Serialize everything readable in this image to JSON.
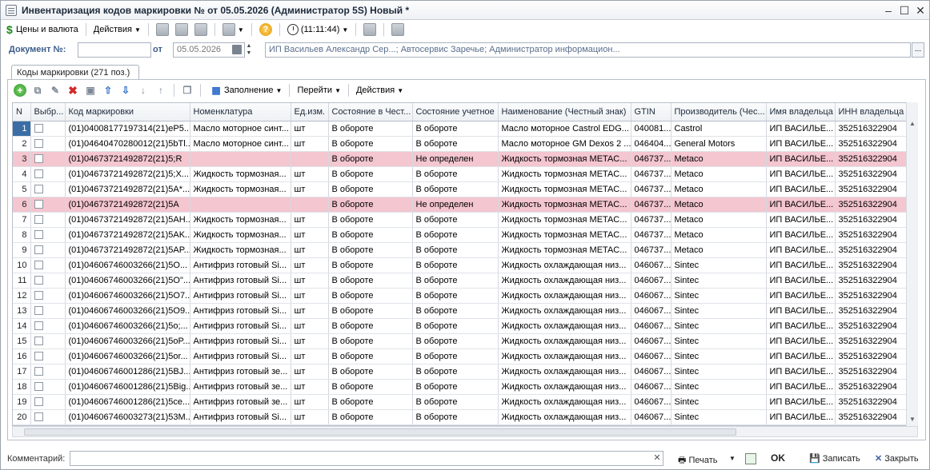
{
  "window": {
    "title": "Инвентаризация кодов маркировки №  от 05.05.2026 (Администратор 5S) Новый *"
  },
  "toolbar": {
    "prices_label": "Цены и валюта",
    "actions_label": "Действия",
    "time_label": "(11:11:44)"
  },
  "doc": {
    "number_label": "Документ №:",
    "number_value": "",
    "from_label": "от",
    "date_value": "05.05.2026",
    "info": "ИП Васильев Александр Сер...; Автосервис Заречье; Администратор информацион...",
    "info_button": "..."
  },
  "tab": {
    "label": "Коды маркировки (271 поз.)"
  },
  "grid_toolbar": {
    "fill_label": "Заполнение",
    "goto_label": "Перейти",
    "actions_label": "Действия"
  },
  "grid": {
    "columns": [
      "N",
      "Выбр...",
      "Код маркировки",
      "Номенклатура",
      "Ед.изм.",
      "Состояние в Чест...",
      "Состояние учетное",
      "Наименование (Честный знак)",
      "GTIN",
      "Производитель (Чес...",
      "Имя владельца",
      "ИНН владельца"
    ],
    "rows": [
      {
        "n": "1",
        "code": "(01)04008177197314(21)eP5...",
        "nom": "Масло моторное синт...",
        "unit": "шт",
        "state_cz": "В обороте",
        "state_acc": "В обороте",
        "name_cz": "Масло моторное Castrol EDG...",
        "gtin": "040081...",
        "maker": "Castrol",
        "owner": "ИП ВАСИЛЬЕ...",
        "inn": "352516322904",
        "pink": false
      },
      {
        "n": "2",
        "code": "(01)04640470280012(21)5bTl...",
        "nom": "Масло моторное синт...",
        "unit": "шт",
        "state_cz": "В обороте",
        "state_acc": "В обороте",
        "name_cz": "Масло моторное GM Dexos 2 ...",
        "gtin": "046404...",
        "maker": "General Motors",
        "owner": "ИП ВАСИЛЬЕ...",
        "inn": "352516322904",
        "pink": false
      },
      {
        "n": "3",
        "code": "(01)04673721492872(21)5;R",
        "nom": "",
        "unit": "",
        "state_cz": "В обороте",
        "state_acc": "Не определен",
        "name_cz": "Жидкость тормозная METAC...",
        "gtin": "046737...",
        "maker": "Metaco",
        "owner": "ИП ВАСИЛЬЕ...",
        "inn": "352516322904",
        "pink": true
      },
      {
        "n": "4",
        "code": "(01)04673721492872(21)5;X...",
        "nom": "Жидкость тормозная...",
        "unit": "шт",
        "state_cz": "В обороте",
        "state_acc": "В обороте",
        "name_cz": "Жидкость тормозная METAC...",
        "gtin": "046737...",
        "maker": "Metaco",
        "owner": "ИП ВАСИЛЬЕ...",
        "inn": "352516322904",
        "pink": false
      },
      {
        "n": "5",
        "code": "(01)04673721492872(21)5A*...",
        "nom": "Жидкость тормозная...",
        "unit": "шт",
        "state_cz": "В обороте",
        "state_acc": "В обороте",
        "name_cz": "Жидкость тормозная METAC...",
        "gtin": "046737...",
        "maker": "Metaco",
        "owner": "ИП ВАСИЛЬЕ...",
        "inn": "352516322904",
        "pink": false
      },
      {
        "n": "6",
        "code": "(01)04673721492872(21)5A",
        "nom": "",
        "unit": "",
        "state_cz": "В обороте",
        "state_acc": "Не определен",
        "name_cz": "Жидкость тормозная METAC...",
        "gtin": "046737...",
        "maker": "Metaco",
        "owner": "ИП ВАСИЛЬЕ...",
        "inn": "352516322904",
        "pink": true
      },
      {
        "n": "7",
        "code": "(01)04673721492872(21)5AH...",
        "nom": "Жидкость тормозная...",
        "unit": "шт",
        "state_cz": "В обороте",
        "state_acc": "В обороте",
        "name_cz": "Жидкость тормозная METAC...",
        "gtin": "046737...",
        "maker": "Metaco",
        "owner": "ИП ВАСИЛЬЕ...",
        "inn": "352516322904",
        "pink": false
      },
      {
        "n": "8",
        "code": "(01)04673721492872(21)5AK...",
        "nom": "Жидкость тормозная...",
        "unit": "шт",
        "state_cz": "В обороте",
        "state_acc": "В обороте",
        "name_cz": "Жидкость тормозная METAC...",
        "gtin": "046737...",
        "maker": "Metaco",
        "owner": "ИП ВАСИЛЬЕ...",
        "inn": "352516322904",
        "pink": false
      },
      {
        "n": "9",
        "code": "(01)04673721492872(21)5AP...",
        "nom": "Жидкость тормозная...",
        "unit": "шт",
        "state_cz": "В обороте",
        "state_acc": "В обороте",
        "name_cz": "Жидкость тормозная METAC...",
        "gtin": "046737...",
        "maker": "Metaco",
        "owner": "ИП ВАСИЛЬЕ...",
        "inn": "352516322904",
        "pink": false
      },
      {
        "n": "10",
        "code": "(01)04606746003266(21)5O...",
        "nom": "Антифриз готовый Si...",
        "unit": "шт",
        "state_cz": "В обороте",
        "state_acc": "В обороте",
        "name_cz": "Жидкость охлаждающая низ...",
        "gtin": "046067...",
        "maker": "Sintec",
        "owner": "ИП ВАСИЛЬЕ...",
        "inn": "352516322904",
        "pink": false
      },
      {
        "n": "11",
        "code": "(01)04606746003266(21)5O\"...",
        "nom": "Антифриз готовый Si...",
        "unit": "шт",
        "state_cz": "В обороте",
        "state_acc": "В обороте",
        "name_cz": "Жидкость охлаждающая низ...",
        "gtin": "046067...",
        "maker": "Sintec",
        "owner": "ИП ВАСИЛЬЕ...",
        "inn": "352516322904",
        "pink": false
      },
      {
        "n": "12",
        "code": "(01)04606746003266(21)5O7...",
        "nom": "Антифриз готовый Si...",
        "unit": "шт",
        "state_cz": "В обороте",
        "state_acc": "В обороте",
        "name_cz": "Жидкость охлаждающая низ...",
        "gtin": "046067...",
        "maker": "Sintec",
        "owner": "ИП ВАСИЛЬЕ...",
        "inn": "352516322904",
        "pink": false
      },
      {
        "n": "13",
        "code": "(01)04606746003266(21)5O9...",
        "nom": "Антифриз готовый Si...",
        "unit": "шт",
        "state_cz": "В обороте",
        "state_acc": "В обороте",
        "name_cz": "Жидкость охлаждающая низ...",
        "gtin": "046067...",
        "maker": "Sintec",
        "owner": "ИП ВАСИЛЬЕ...",
        "inn": "352516322904",
        "pink": false
      },
      {
        "n": "14",
        "code": "(01)04606746003266(21)5o;...",
        "nom": "Антифриз готовый Si...",
        "unit": "шт",
        "state_cz": "В обороте",
        "state_acc": "В обороте",
        "name_cz": "Жидкость охлаждающая низ...",
        "gtin": "046067...",
        "maker": "Sintec",
        "owner": "ИП ВАСИЛЬЕ...",
        "inn": "352516322904",
        "pink": false
      },
      {
        "n": "15",
        "code": "(01)04606746003266(21)5oP...",
        "nom": "Антифриз готовый Si...",
        "unit": "шт",
        "state_cz": "В обороте",
        "state_acc": "В обороте",
        "name_cz": "Жидкость охлаждающая низ...",
        "gtin": "046067...",
        "maker": "Sintec",
        "owner": "ИП ВАСИЛЬЕ...",
        "inn": "352516322904",
        "pink": false
      },
      {
        "n": "16",
        "code": "(01)04606746003266(21)5or...",
        "nom": "Антифриз готовый Si...",
        "unit": "шт",
        "state_cz": "В обороте",
        "state_acc": "В обороте",
        "name_cz": "Жидкость охлаждающая низ...",
        "gtin": "046067...",
        "maker": "Sintec",
        "owner": "ИП ВАСИЛЬЕ...",
        "inn": "352516322904",
        "pink": false
      },
      {
        "n": "17",
        "code": "(01)04606746001286(21)5BJ...",
        "nom": "Антифриз готовый зе...",
        "unit": "шт",
        "state_cz": "В обороте",
        "state_acc": "В обороте",
        "name_cz": "Жидкость охлаждающая низ...",
        "gtin": "046067...",
        "maker": "Sintec",
        "owner": "ИП ВАСИЛЬЕ...",
        "inn": "352516322904",
        "pink": false
      },
      {
        "n": "18",
        "code": "(01)04606746001286(21)5Big...",
        "nom": "Антифриз готовый зе...",
        "unit": "шт",
        "state_cz": "В обороте",
        "state_acc": "В обороте",
        "name_cz": "Жидкость охлаждающая низ...",
        "gtin": "046067...",
        "maker": "Sintec",
        "owner": "ИП ВАСИЛЬЕ...",
        "inn": "352516322904",
        "pink": false
      },
      {
        "n": "19",
        "code": "(01)04606746001286(21)5ce...",
        "nom": "Антифриз готовый зе...",
        "unit": "шт",
        "state_cz": "В обороте",
        "state_acc": "В обороте",
        "name_cz": "Жидкость охлаждающая низ...",
        "gtin": "046067...",
        "maker": "Sintec",
        "owner": "ИП ВАСИЛЬЕ...",
        "inn": "352516322904",
        "pink": false
      },
      {
        "n": "20",
        "code": "(01)04606746003273(21)53M...",
        "nom": "Антифриз готовый Si...",
        "unit": "шт",
        "state_cz": "В обороте",
        "state_acc": "В обороте",
        "name_cz": "Жидкость охлаждающая низ...",
        "gtin": "046067...",
        "maker": "Sintec",
        "owner": "ИП ВАСИЛЬЕ...",
        "inn": "352516322904",
        "pink": false
      }
    ]
  },
  "bottom": {
    "comment_label": "Комментарий:",
    "comment_value": "",
    "print_label": "Печать",
    "ok_label": "OK",
    "save_label": "Записать",
    "close_label": "Закрыть"
  },
  "colors": {
    "error_row": "#f4c6d0",
    "selected_n": "#3a6ea5",
    "label_blue": "#3d5d8a"
  }
}
